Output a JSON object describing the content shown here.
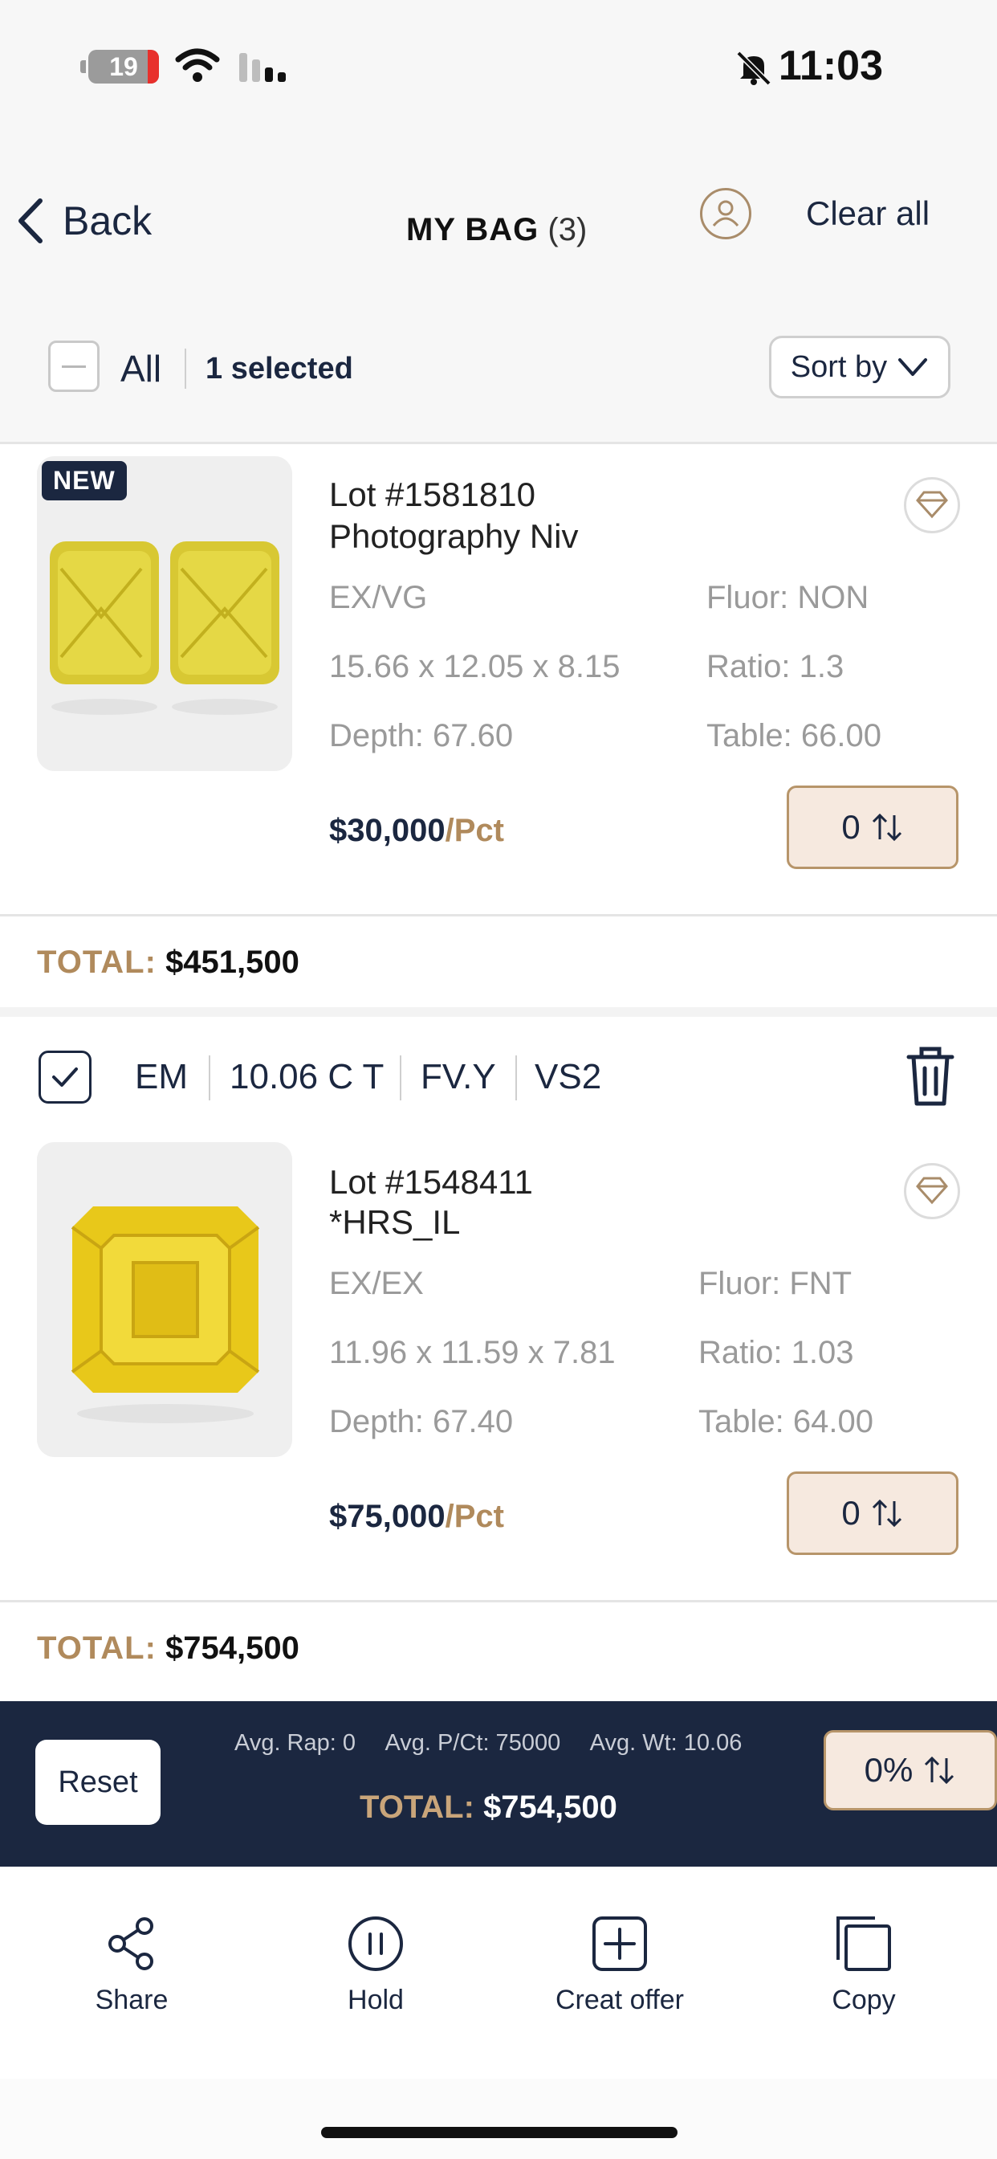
{
  "status_bar": {
    "battery": "19",
    "time": "11:03"
  },
  "header": {
    "back_label": "Back",
    "title": "MY BAG",
    "count": "(3)",
    "clear_all": "Clear all"
  },
  "selection_bar": {
    "all_label": "All",
    "selected_text": "1 selected",
    "sort_label": "Sort by"
  },
  "items": [
    {
      "badge": "NEW",
      "lot": "Lot #1581810",
      "name": "Photography Niv",
      "cut": "EX/VG",
      "fluor": "Fluor: NON",
      "measurements": "15.66 x 12.05 x 8.15",
      "ratio": "Ratio: 1.3",
      "depth": "Depth: 67.60",
      "table": "Table: 66.00",
      "price": "$30,000",
      "price_unit": "/Pct",
      "qty": "0",
      "total_label": "TOTAL:",
      "total_value": "$451,500"
    },
    {
      "shape": "EM",
      "carat": "10.06 C T",
      "color": "FV.Y",
      "clarity": "VS2",
      "lot": "Lot #1548411",
      "name": "*HRS_IL",
      "cut": "EX/EX",
      "fluor": "Fluor: FNT",
      "measurements": "11.96 x 11.59 x 7.81",
      "ratio": "Ratio: 1.03",
      "depth": "Depth: 67.40",
      "table": "Table: 64.00",
      "price": "$75,000",
      "price_unit": "/Pct",
      "qty": "0",
      "total_label": "TOTAL:",
      "total_value": "$754,500"
    }
  ],
  "footer": {
    "reset_label": "Reset",
    "avg_rap": "Avg. Rap: 0",
    "avg_pct": "Avg. P/Ct: 75000",
    "avg_wt": "Avg. Wt: 10.06",
    "total_label": "TOTAL:",
    "total_value": "$754,500",
    "pct": "0%"
  },
  "actions": [
    {
      "label": "Share",
      "icon": "share-icon"
    },
    {
      "label": "Hold",
      "icon": "pause-icon"
    },
    {
      "label": "Creat offer",
      "icon": "plus-square-icon"
    },
    {
      "label": "Copy",
      "icon": "copy-icon"
    }
  ],
  "colors": {
    "navy": "#1b2740",
    "gold": "#b08a5c",
    "accent_bg": "#f6e9df"
  }
}
